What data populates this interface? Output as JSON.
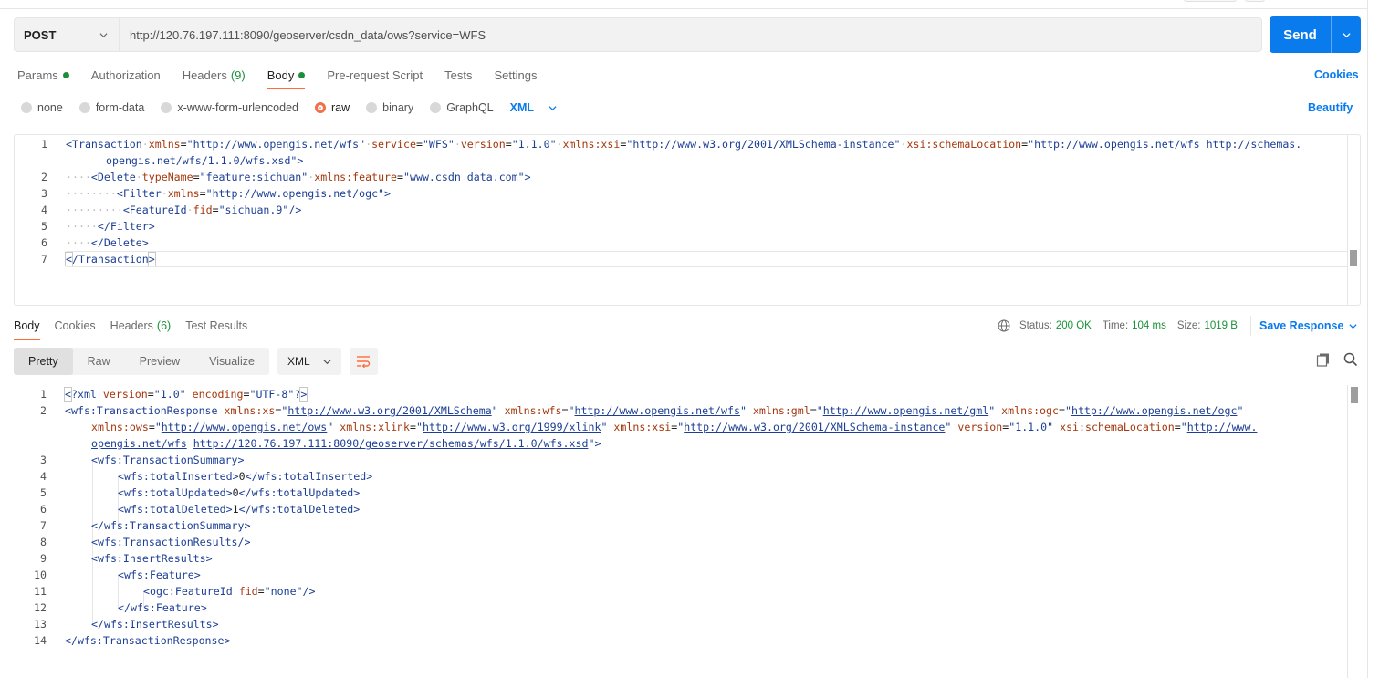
{
  "request": {
    "method": "POST",
    "url": "http://120.76.197.111:8090/geoserver/csdn_data/ows?service=WFS",
    "send_label": "Send"
  },
  "request_tabs": [
    {
      "label": "Params",
      "dot": true
    },
    {
      "label": "Authorization"
    },
    {
      "label": "Headers",
      "count": "(9)"
    },
    {
      "label": "Body",
      "dot": true,
      "active": true
    },
    {
      "label": "Pre-request Script"
    },
    {
      "label": "Tests"
    },
    {
      "label": "Settings"
    }
  ],
  "cookies_label": "Cookies",
  "body_types": [
    {
      "label": "none"
    },
    {
      "label": "form-data"
    },
    {
      "label": "x-www-form-urlencoded"
    },
    {
      "label": "raw",
      "selected": true
    },
    {
      "label": "binary"
    },
    {
      "label": "GraphQL"
    }
  ],
  "raw_language": "XML",
  "beautify_label": "Beautify",
  "request_body_lines": [
    {
      "n": "1",
      "text": "<Transaction xmlns=\"http://www.opengis.net/wfs\" service=\"WFS\" version=\"1.1.0\" xmlns:xsi=\"http://www.w3.org/2001/XMLSchema-instance\" xsi:schemaLocation=\"http://www.opengis.net/wfs http://schemas."
    },
    {
      "n": "",
      "text": "opengis.net/wfs/1.1.0/wfs.xsd\">"
    },
    {
      "n": "2",
      "text": "<Delete typeName=\"feature:sichuan\" xmlns:feature=\"www.csdn_data.com\">"
    },
    {
      "n": "3",
      "text": "<Filter xmlns=\"http://www.opengis.net/ogc\">"
    },
    {
      "n": "4",
      "text": "<FeatureId fid=\"sichuan.9\"/>"
    },
    {
      "n": "5",
      "text": "</Filter>"
    },
    {
      "n": "6",
      "text": "</Delete>"
    },
    {
      "n": "7",
      "text": "</Transaction>"
    }
  ],
  "response_tabs": [
    {
      "label": "Body",
      "active": true
    },
    {
      "label": "Cookies"
    },
    {
      "label": "Headers",
      "count": "(6)"
    },
    {
      "label": "Test Results"
    }
  ],
  "response_meta": {
    "status_label": "Status:",
    "status_value": "200 OK",
    "time_label": "Time:",
    "time_value": "104 ms",
    "size_label": "Size:",
    "size_value": "1019 B",
    "save_label": "Save Response"
  },
  "view_modes": [
    "Pretty",
    "Raw",
    "Preview",
    "Visualize"
  ],
  "response_format": "XML",
  "response_lines": [
    {
      "n": "1",
      "text": "<?xml version=\"1.0\" encoding=\"UTF-8\"?>"
    },
    {
      "n": "2",
      "text": "<wfs:TransactionResponse xmlns:xs=\"http://www.w3.org/2001/XMLSchema\" xmlns:wfs=\"http://www.opengis.net/wfs\" xmlns:gml=\"http://www.opengis.net/gml\" xmlns:ogc=\"http://www.opengis.net/ogc\""
    },
    {
      "n": "",
      "text": "xmlns:ows=\"http://www.opengis.net/ows\" xmlns:xlink=\"http://www.w3.org/1999/xlink\" xmlns:xsi=\"http://www.w3.org/2001/XMLSchema-instance\" version=\"1.1.0\" xsi:schemaLocation=\"http://www."
    },
    {
      "n": "",
      "text": "opengis.net/wfs http://120.76.197.111:8090/geoserver/schemas/wfs/1.1.0/wfs.xsd\">"
    },
    {
      "n": "3",
      "text": "<wfs:TransactionSummary>"
    },
    {
      "n": "4",
      "text": "<wfs:totalInserted>0</wfs:totalInserted>"
    },
    {
      "n": "5",
      "text": "<wfs:totalUpdated>0</wfs:totalUpdated>"
    },
    {
      "n": "6",
      "text": "<wfs:totalDeleted>1</wfs:totalDeleted>"
    },
    {
      "n": "7",
      "text": "</wfs:TransactionSummary>"
    },
    {
      "n": "8",
      "text": "<wfs:TransactionResults/>"
    },
    {
      "n": "9",
      "text": "<wfs:InsertResults>"
    },
    {
      "n": "10",
      "text": "<wfs:Feature>"
    },
    {
      "n": "11",
      "text": "<ogc:FeatureId fid=\"none\"/>"
    },
    {
      "n": "12",
      "text": "</wfs:Feature>"
    },
    {
      "n": "13",
      "text": "</wfs:InsertResults>"
    },
    {
      "n": "14",
      "text": "</wfs:TransactionResponse>"
    }
  ],
  "colors": {
    "accent": "#097bed",
    "active_tab_underline": "#ff6c37",
    "success": "#1a8f3a",
    "tag": "#1c3f95",
    "attribute": "#a5370c"
  }
}
